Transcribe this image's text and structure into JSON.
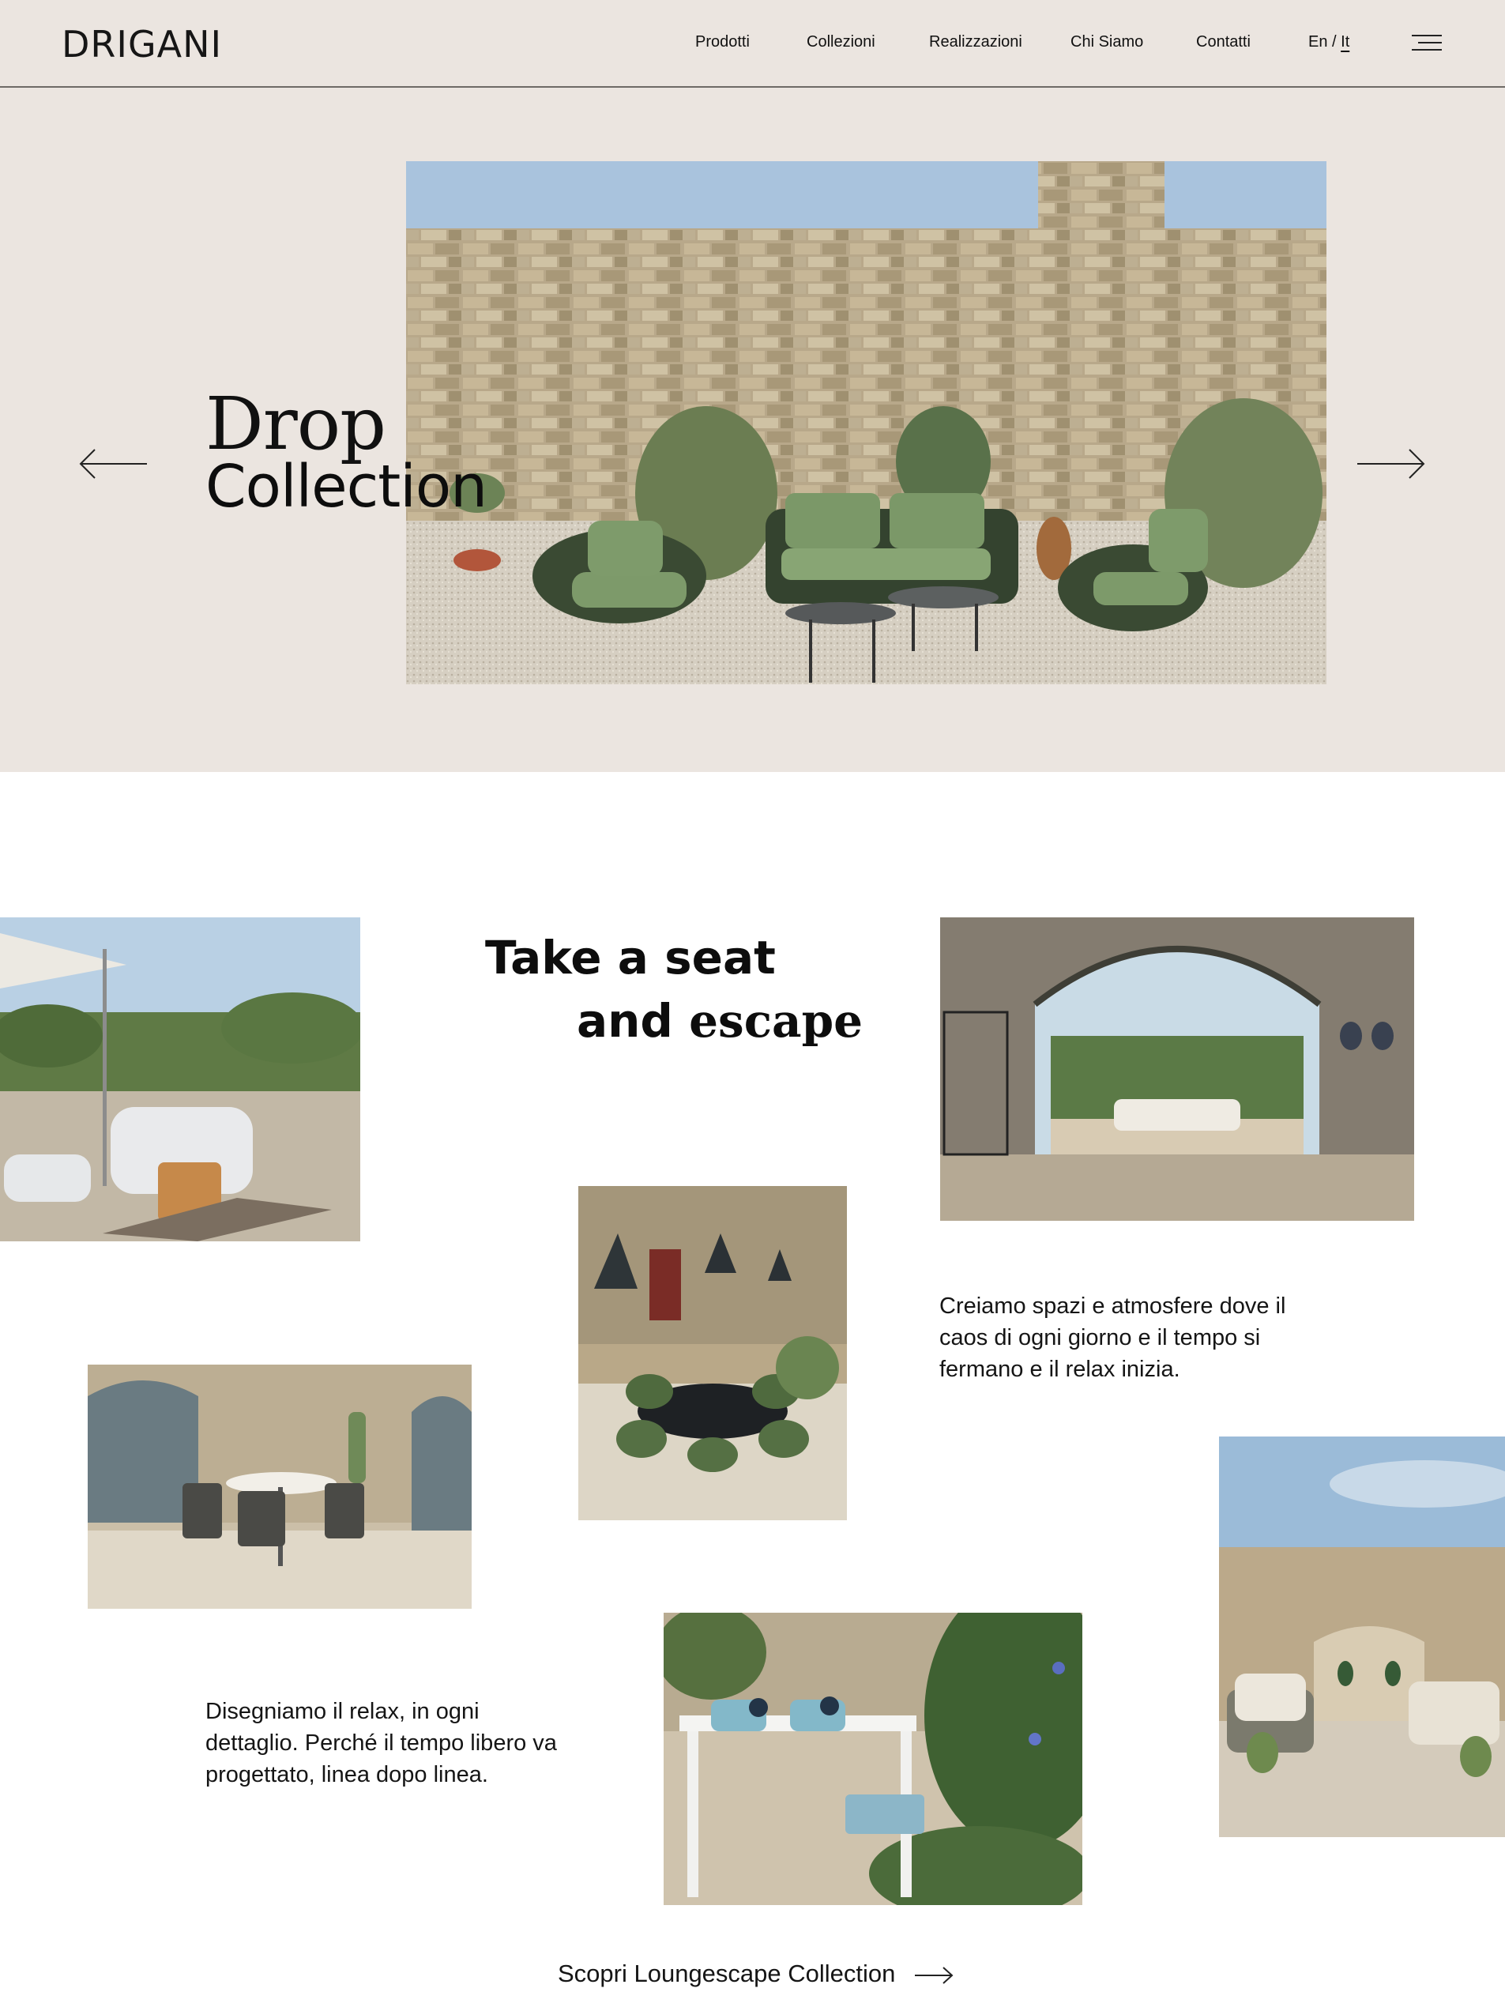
{
  "brand": {
    "logo": "DRIGANI"
  },
  "nav": {
    "items": [
      {
        "label": "Prodotti"
      },
      {
        "label": "Collezioni"
      },
      {
        "label": "Realizzazioni"
      },
      {
        "label": "Chi Siamo"
      },
      {
        "label": "Contatti"
      }
    ],
    "lang_en": "En",
    "lang_sep": " / ",
    "lang_it": "It",
    "menu_icon": "hamburger-icon"
  },
  "hero": {
    "title_line1": "Drop",
    "title_line2": "Collection",
    "prev_icon": "arrow-left-icon",
    "next_icon": "arrow-right-icon"
  },
  "intro": {
    "heading_line1": "Take a seat",
    "heading_line2a": "and ",
    "heading_line2b": "escape",
    "para1": "Creiamo spazi e atmosfere dove il caos di ogni giorno e il tempo si fermano e il relax inizia.",
    "para2": "Disegniamo il relax, in ogni dettaglio. Perché il tempo libero va progettato, linea dopo linea.",
    "cta": "Scopri Loungescape Collection",
    "cta_icon": "arrow-right-icon"
  },
  "colors": {
    "header_bg": "#ebe5e0",
    "text": "#111111",
    "accent_green": "#5f7a52"
  }
}
